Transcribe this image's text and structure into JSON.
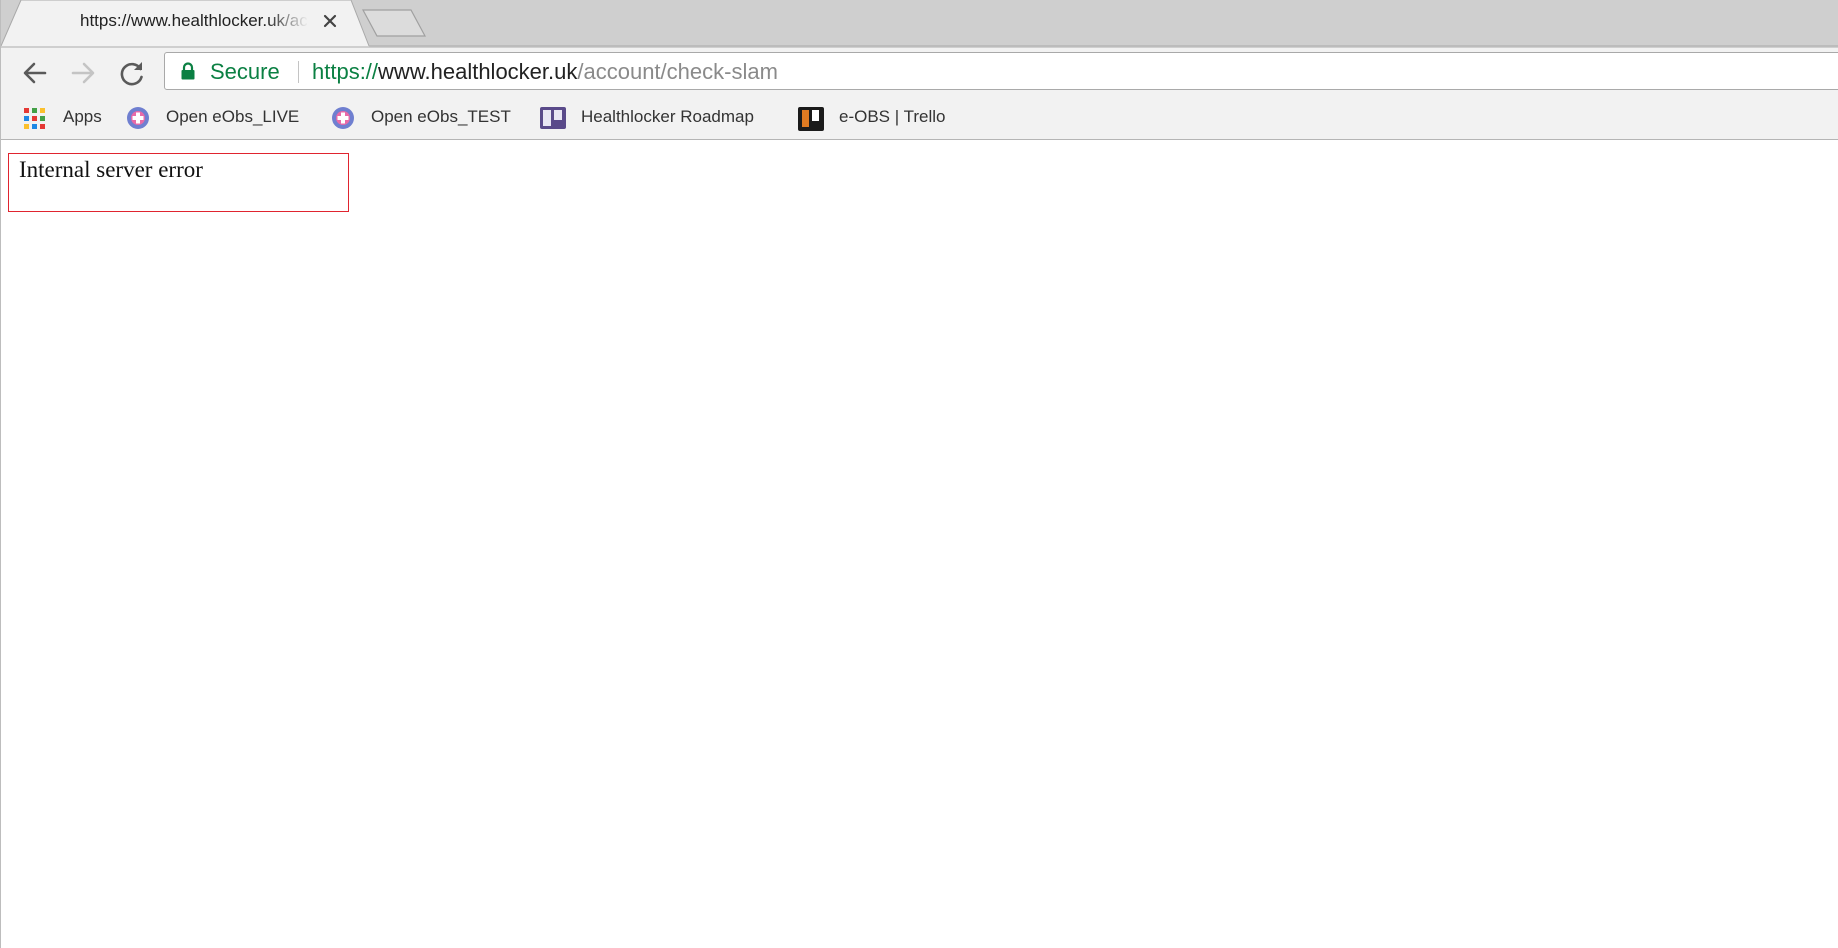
{
  "tab": {
    "title": "https://www.healthlocker.uk/account/check-slam",
    "close_icon": "close-icon",
    "new_tab_icon": "new-tab-icon"
  },
  "toolbar": {
    "back_icon": "arrow-left-icon",
    "forward_icon": "arrow-right-icon",
    "reload_icon": "reload-icon",
    "omnibox": {
      "security_icon": "lock-icon",
      "security_label": "Secure",
      "url_scheme": "https://",
      "url_host": "www.healthlocker.uk",
      "url_path": "/account/check-slam"
    }
  },
  "bookmarks": [
    {
      "label": "Apps",
      "icon": "apps-grid-icon"
    },
    {
      "label": "Open eObs_LIVE",
      "icon": "eobs-cross-icon"
    },
    {
      "label": "Open eObs_TEST",
      "icon": "eobs-cross-icon"
    },
    {
      "label": "Healthlocker Roadmap",
      "icon": "trello-board-icon"
    },
    {
      "label": "e-OBS | Trello",
      "icon": "trello-board-icon"
    }
  ],
  "page": {
    "error_message": "Internal server error"
  },
  "colors": {
    "secure_green": "#0b8043",
    "error_border": "#e0242f",
    "tabstrip_bg": "#cfcfcf",
    "toolbar_bg": "#f2f2f2",
    "eobs_icon": "#6f7fd0",
    "trello_icon": "#5a4a8a"
  }
}
